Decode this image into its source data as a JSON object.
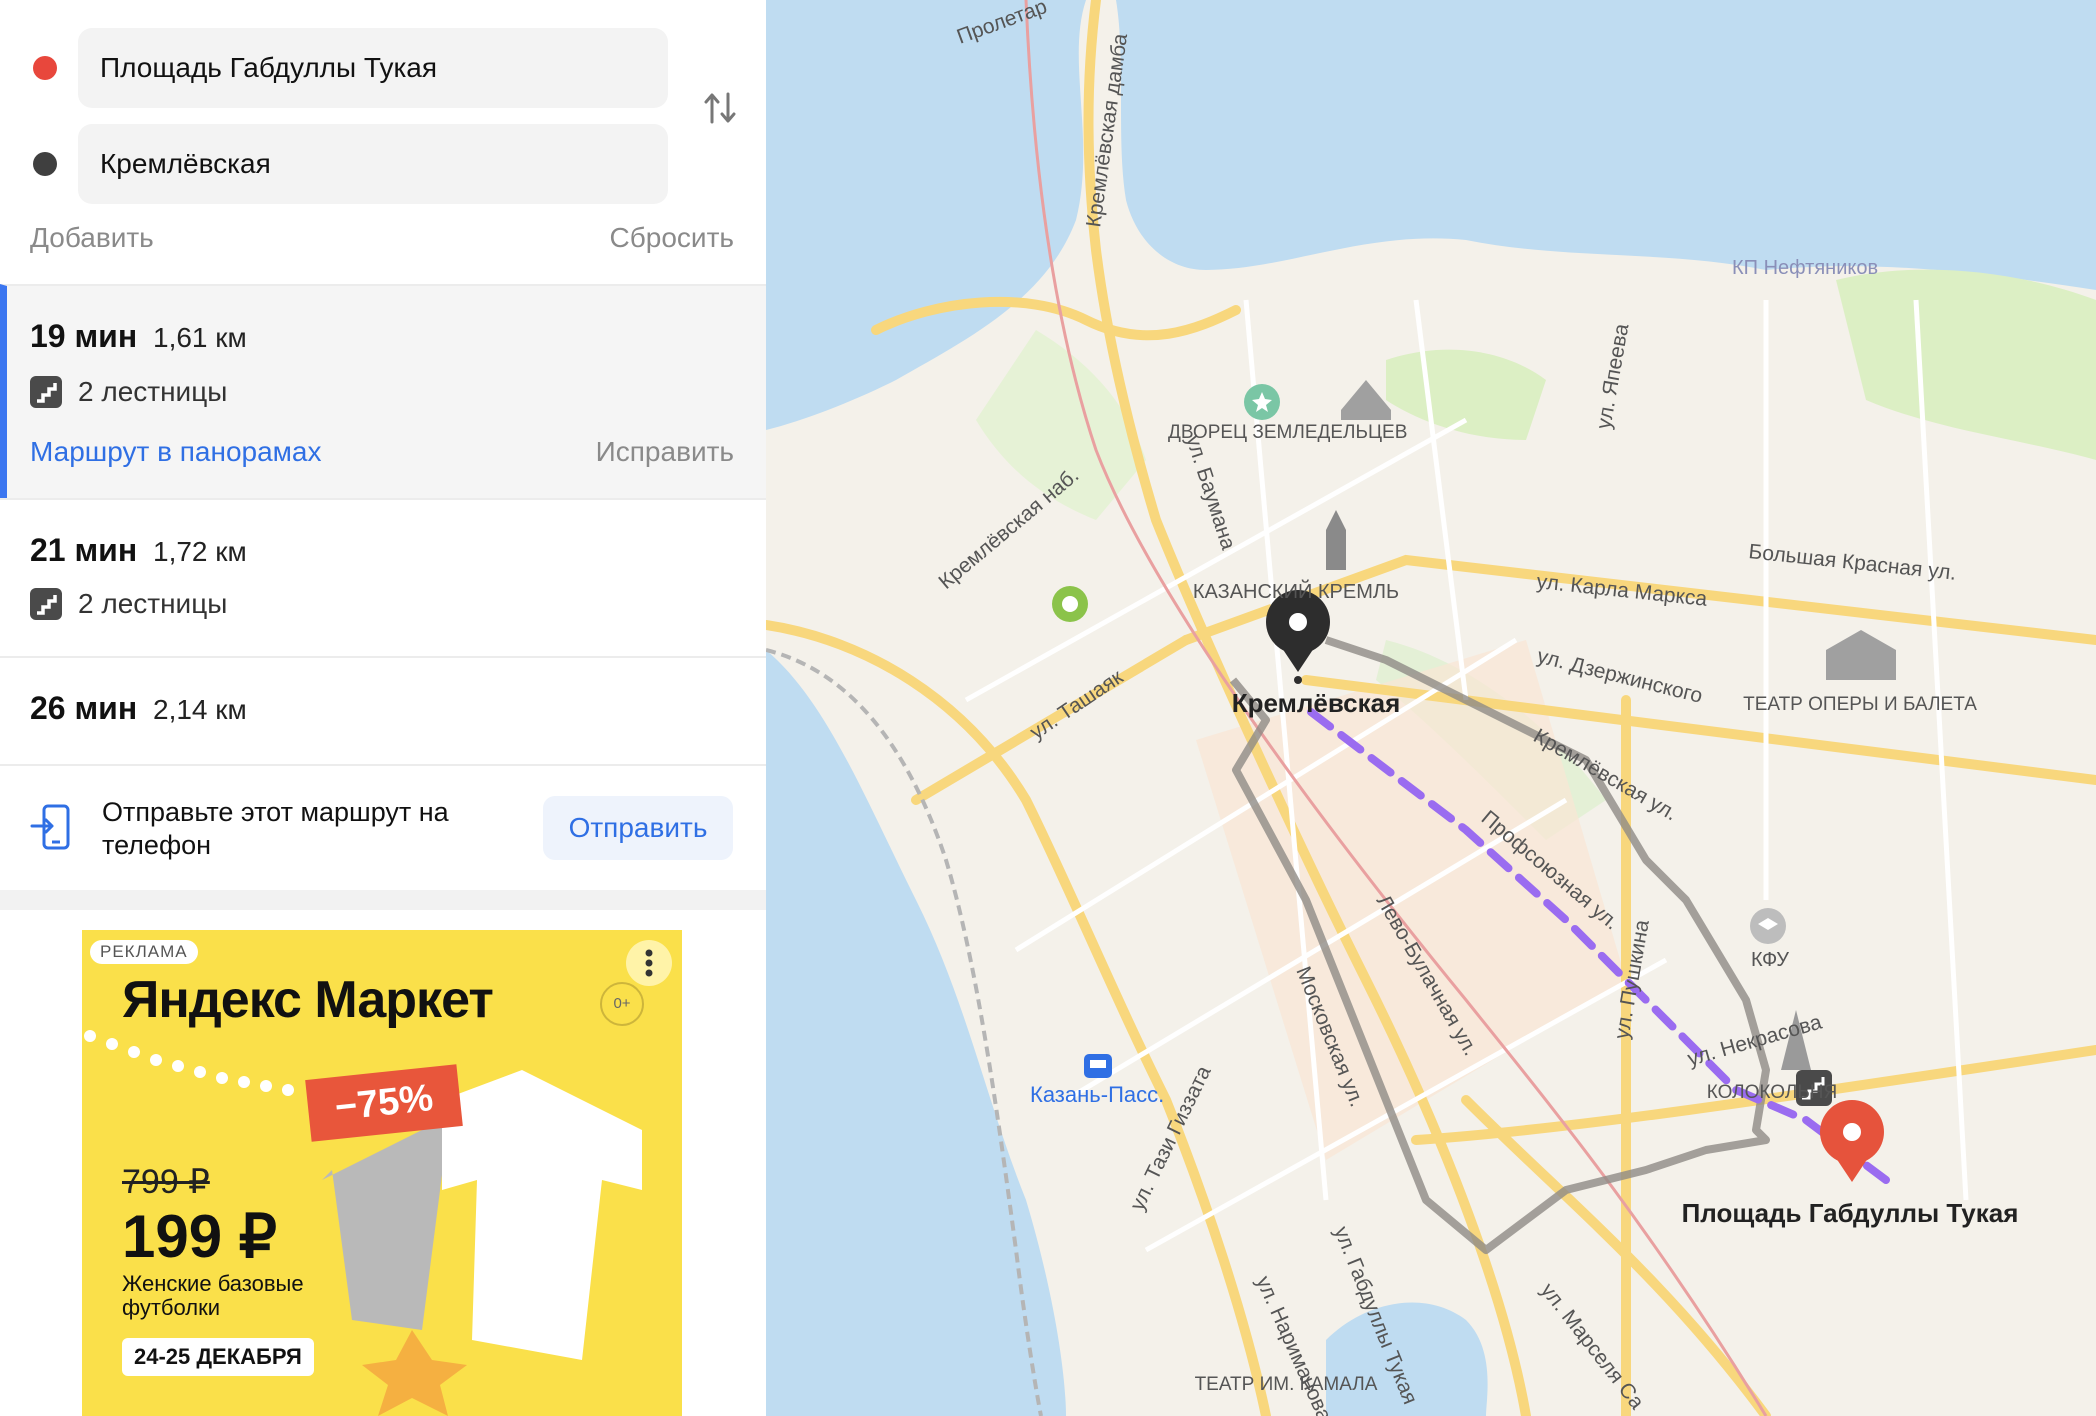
{
  "route_panel": {
    "from": "Площадь Габдуллы Тукая",
    "to": "Кремлёвская",
    "add_label": "Добавить",
    "reset_label": "Сбросить",
    "routes": [
      {
        "time": "19 мин",
        "distance": "1,61 км",
        "stairs": "2 лестницы",
        "panorama_link": "Маршрут в панорамах",
        "fix_link": "Исправить"
      },
      {
        "time": "21 мин",
        "distance": "1,72 км",
        "stairs": "2 лестницы"
      },
      {
        "time": "26 мин",
        "distance": "2,14 км"
      }
    ],
    "send_text": "Отправьте этот маршрут на телефон",
    "send_button": "Отправить"
  },
  "ad": {
    "label": "РЕКЛАМА",
    "brand": "Яндекс Маркет",
    "age": "0+",
    "discount": "−75%",
    "old_price": "799 ₽",
    "new_price": "199 ₽",
    "description": "Женские базовые футболки",
    "dates": "24-25 ДЕКАБРЯ"
  },
  "map": {
    "colors": {
      "water": "#bfdcf1",
      "land": "#f4f1ea",
      "road": "#f8d77d",
      "park": "#dcefc4",
      "route": "#9a6cf0",
      "alt_route": "#8e8b86",
      "pin_start": "#e6533c",
      "pin_end": "#2d2d2d"
    },
    "labels": {
      "start_pin": "Кремлёвская",
      "end_pin": "Площадь Габдуллы Тукая",
      "kremlin": "КАЗАНСКИЙ КРЕМЛЬ",
      "dvorets": "ДВОРЕЦ ЗЕМЛЕДЕЛЬЦЕВ",
      "theatre_opera": "ТЕАТР ОПЕРЫ И БАЛЕТА",
      "theatre_kamala": "ТЕАТР ИМ. КАМАЛА",
      "kfu": "КФУ",
      "kolokolnya": "КОЛОКОЛЬНЯ",
      "kp_neftyanikov": "КП Нефтяников",
      "station": "Казань-Пасс.",
      "streets": {
        "kremlevskaya_damba": "Кремлёвская дамба",
        "kremlevskaya_nab": "Кремлёвская наб.",
        "baumana": "ул. Баумана",
        "yapeeva": "ул. Япеева",
        "karla_marksa": "ул. Карла Маркса",
        "bolshaya_krasnaya": "Большая Красная ул.",
        "dzerzhinskogo": "ул. Дзержинского",
        "kremlevskaya_ul": "Кремлёвская ул.",
        "profsoyuznaya": "Профсоюзная ул.",
        "tashayak": "ул. Ташаяк",
        "levo_bulachnaya": "Лево-Булачная ул.",
        "moskovskaya": "Московская ул.",
        "tazi_gizzata": "ул. Тази Гиззата",
        "narimanova": "ул. Нариманова",
        "gabdully_tukaya": "ул. Габдуллы Тукая",
        "marselya_salimzhanova": "ул. Марселя Са",
        "pushkina": "ул. Пушкина",
        "nekrasova": "ул. Некрасова",
        "proletarskaya": "Пролетар"
      }
    }
  }
}
